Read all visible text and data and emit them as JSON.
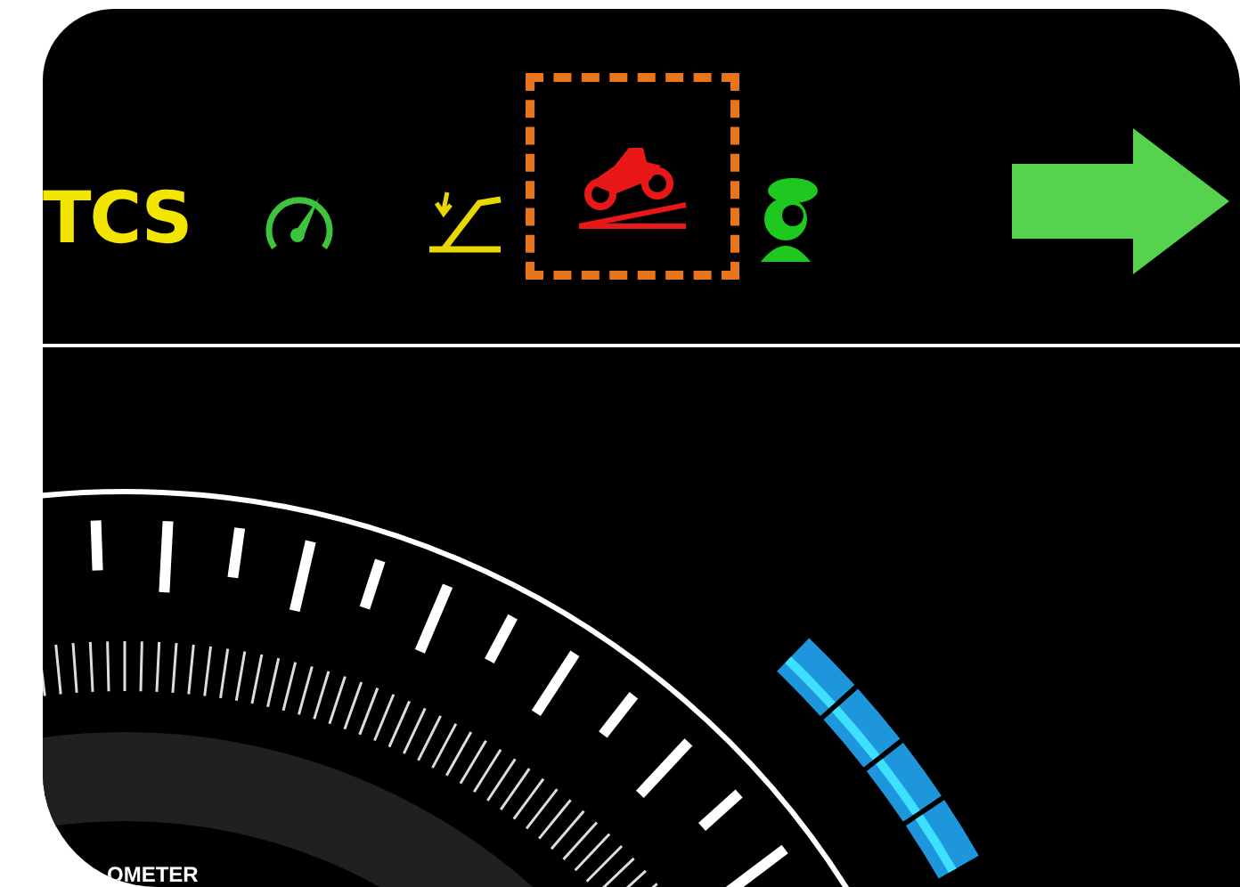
{
  "indicators": [
    {
      "kind": "text",
      "label": "TCS",
      "color": "#f2e600",
      "highlighted": false
    },
    {
      "kind": "speedometer",
      "color": "#3cc43c",
      "highlighted": false
    },
    {
      "kind": "suspension",
      "color": "#e8d800",
      "highlighted": false
    },
    {
      "kind": "hill-start",
      "color": "#e81818",
      "highlighted": true
    },
    {
      "kind": "rider",
      "color": "#1ec81e",
      "highlighted": false
    }
  ],
  "turn_signal": {
    "kind": "right"
  },
  "gauge": {
    "label": "OMETER"
  }
}
